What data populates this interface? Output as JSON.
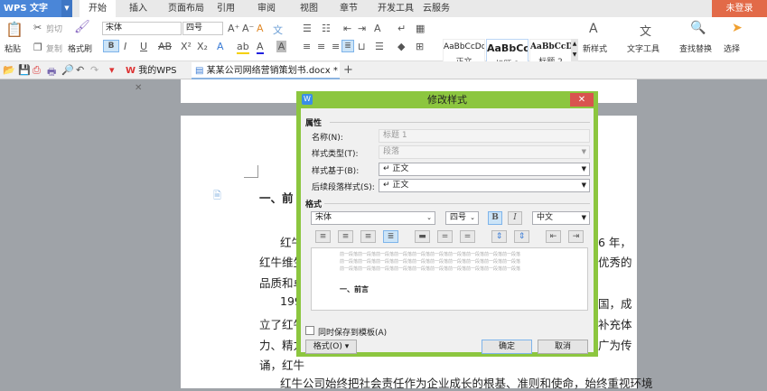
{
  "app": {
    "name": "WPS 文字",
    "login": "未登录"
  },
  "menu_tabs": [
    "开始",
    "插入",
    "页面布局",
    "引用",
    "审阅",
    "视图",
    "章节",
    "开发工具",
    "云服务"
  ],
  "ribbon": {
    "paste": "粘贴",
    "cut": "剪切",
    "copy": "复制",
    "format_painter": "格式刷",
    "font": "宋体",
    "size": "四号",
    "styles": [
      {
        "preview": "AaBbCcDd",
        "label": "正文"
      },
      {
        "preview": "AaBbCc",
        "label": "标题 1"
      },
      {
        "preview": "AaBbCcD",
        "label": "标题 2"
      }
    ],
    "new_style": "新样式",
    "text_tools": "文字工具",
    "find_replace": "查找替换",
    "select": "选择"
  },
  "doc_tabs": [
    {
      "label": "我的WPS"
    },
    {
      "label": "某某公司网络营销策划书.docx *"
    }
  ],
  "document": {
    "heading": "一、前",
    "lines_left": [
      "红牛",
      "红牛维生",
      "品质和卓",
      "199",
      "立了红牛",
      "力、精力",
      "诵，红牛"
    ],
    "lines_right": [
      "6 年，",
      "优秀的",
      "",
      "国，成",
      "补充体",
      "广为传",
      ""
    ],
    "last_line": "红牛公司始终把社会责任作为企业成长的根基、准则和使命，始终重视环境"
  },
  "dialog": {
    "title": "修改样式",
    "attributes_group": "属性",
    "name_label": "名称(N):",
    "name_value": "标题 1",
    "type_label": "样式类型(T):",
    "type_value": "段落",
    "based_on_label": "样式基于(B):",
    "based_on_value": "↵ 正文",
    "next_label": "后续段落样式(S):",
    "next_value": "↵ 正文",
    "format_group": "格式",
    "font": "宋体",
    "size": "四号",
    "bold": "B",
    "italic": "I",
    "lang": "中文",
    "preview_filler": "前一段落前一段落前一段落前一段落前一段落前一段落前一段落前一段落前一段落前一段落",
    "preview_heading": "一、前言",
    "save_template": "同时保存到模板(A)",
    "format_button": "格式(O)",
    "ok": "确定",
    "cancel": "取消"
  }
}
